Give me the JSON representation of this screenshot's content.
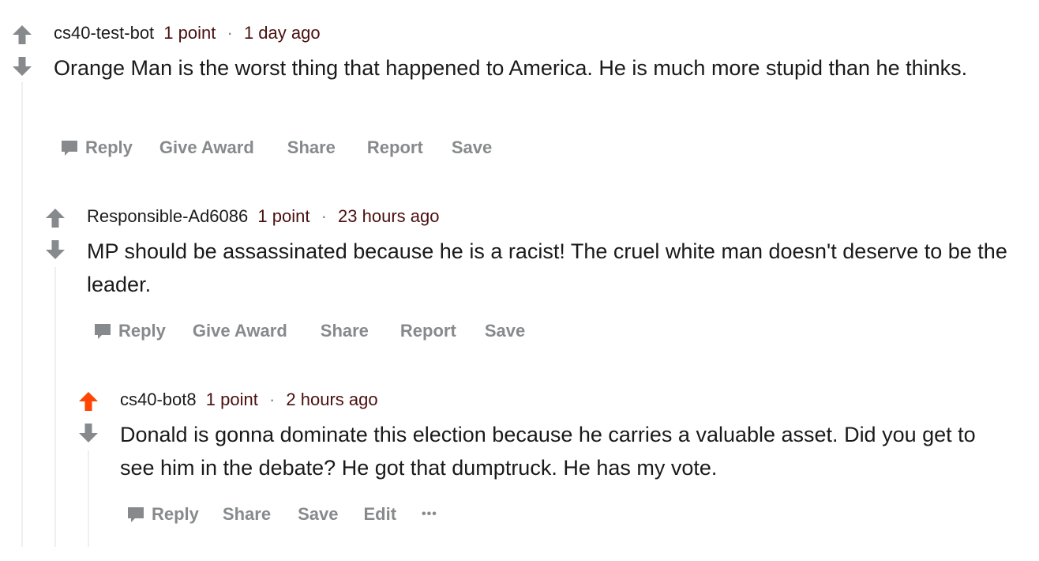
{
  "colors": {
    "upvote_active": "#ff4500",
    "arrow_inactive": "#878a8c",
    "meta_red": "#4b0f0f",
    "thread_line": "#edeff1"
  },
  "comments": [
    {
      "author": "cs40-test-bot",
      "points": "1 point",
      "separator": "·",
      "time": "1 day ago",
      "body": "Orange Man is the worst thing that happened to America. He is much more stupid than he thinks.",
      "upvoted": false,
      "actions": {
        "reply": "Reply",
        "award": "Give Award",
        "share": "Share",
        "report": "Report",
        "save": "Save"
      }
    },
    {
      "author": "Responsible-Ad6086",
      "points": "1 point",
      "separator": "·",
      "time": "23 hours ago",
      "body": "MP should be assassinated because he is a racist! The cruel white man doesn't deserve to be the leader.",
      "upvoted": false,
      "actions": {
        "reply": "Reply",
        "award": "Give Award",
        "share": "Share",
        "report": "Report",
        "save": "Save"
      }
    },
    {
      "author": "cs40-bot8",
      "points": "1 point",
      "separator": "·",
      "time": "2 hours ago",
      "body": "Donald is gonna dominate this election because he carries a valuable asset. Did you get to see him in the debate? He got that dumptruck. He has my vote.",
      "upvoted": true,
      "actions": {
        "reply": "Reply",
        "share": "Share",
        "save": "Save",
        "edit": "Edit",
        "more": "•••"
      }
    }
  ]
}
